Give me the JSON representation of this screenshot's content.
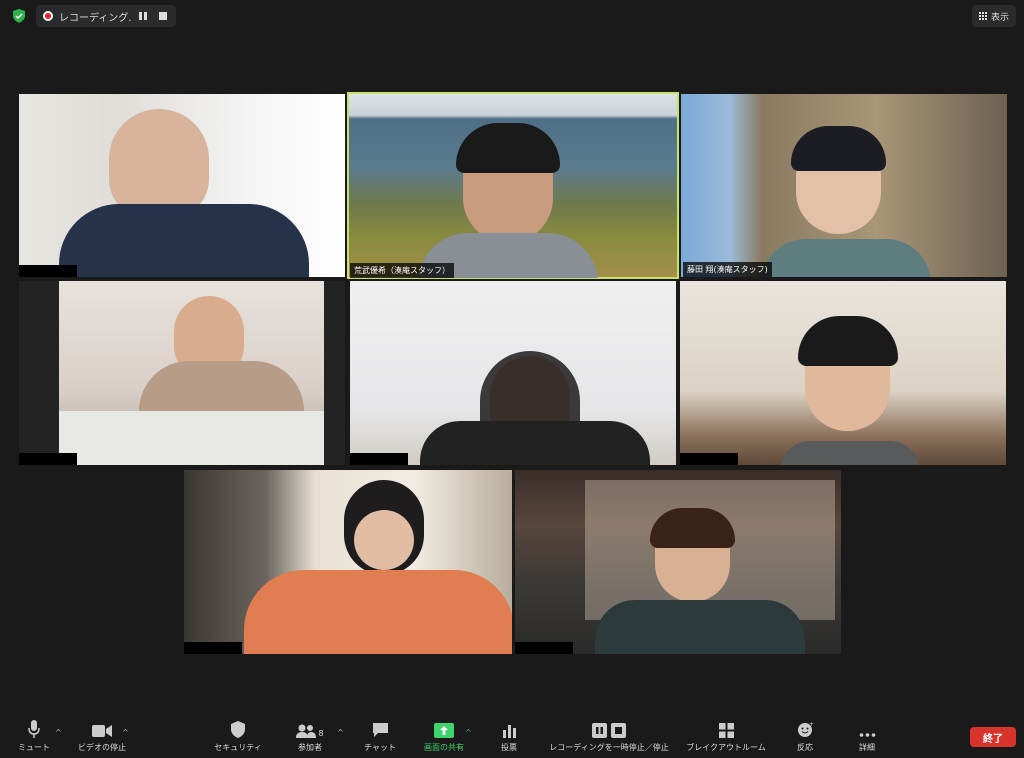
{
  "topbar": {
    "recording_label": "レコーディング...",
    "view_label": "表示"
  },
  "participants": [
    {
      "name": ""
    },
    {
      "name": "荒武優希（湊庵スタッフ）"
    },
    {
      "name": "藤田 翔(湊庵スタッフ)"
    },
    {
      "name": ""
    },
    {
      "name": ""
    },
    {
      "name": ""
    },
    {
      "name": ""
    },
    {
      "name": ""
    }
  ],
  "toolbar": {
    "mute": "ミュート",
    "video_stop": "ビデオの停止",
    "security": "セキュリティ",
    "participants": "参加者",
    "participants_count": "8",
    "chat": "チャット",
    "share_screen": "画面の共有",
    "poll": "投票",
    "recording_pause": "レコーディングを一時停止／停止",
    "breakout": "ブレイクアウトルーム",
    "reactions": "反応",
    "more": "詳細",
    "end": "終了"
  },
  "colors": {
    "accent_green": "#3dd46b",
    "end_red": "#d9342b",
    "active_speaker_border": "#c8e070"
  }
}
